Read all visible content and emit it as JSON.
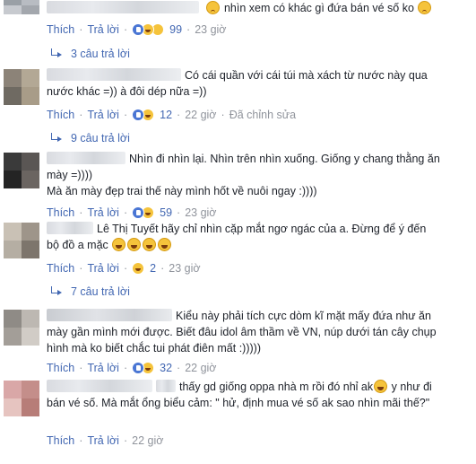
{
  "comments": [
    {
      "text": "nhìn xem có khác gì đứa bán vé số ko",
      "actions": {
        "like": "Thích",
        "reply": "Trả lời",
        "count": "99",
        "time": "23 giờ"
      },
      "replies": "3 câu trả lời"
    },
    {
      "text_line1": "Có cái quần với cái túi mà xách từ nước này qua",
      "text_line2": "nước khác =)) à đôi dép nữa =))",
      "actions": {
        "like": "Thích",
        "reply": "Trả lời",
        "count": "12",
        "time": "22 giờ",
        "edited": "Đã chỉnh sửa"
      },
      "replies": "9 câu trả lời"
    },
    {
      "text_line1": "Nhìn đi nhìn lại. Nhìn trên nhìn xuống. Giống y chang thằng ăn",
      "text_line2": "mày =))))",
      "text_line3": "Mà ăn mày đẹp trai thế này mình hốt về nuôi ngay :))))",
      "actions": {
        "like": "Thích",
        "reply": "Trả lời",
        "count": "59",
        "time": "23 giờ"
      }
    },
    {
      "author": "Lê Thị Tuyết",
      "text_line1": "hãy chỉ nhìn cặp mắt ngơ ngác của a. Đừng để ý đến",
      "text_line2": "bộ đồ a mặc",
      "actions": {
        "like": "Thích",
        "reply": "Trả lời",
        "count": "2",
        "time": "23 giờ"
      },
      "replies": "7 câu trả lời"
    },
    {
      "text_line1": "Kiểu này phải tích cực dòm kĩ mặt mấy đứa như ăn",
      "text_line2": "mày gần mình mới được. Biết đâu idol âm thầm về VN, núp dưới tán cây chụp",
      "text_line3": "hình mà ko biết chắc tui phát điên mất :)))))",
      "actions": {
        "like": "Thích",
        "reply": "Trả lời",
        "count": "32",
        "time": "22 giờ"
      }
    },
    {
      "text_line1a": "thấy gd giống oppa nhà m rồi đó nhỉ ak",
      "text_line1b": "y như đi",
      "text_line2": "bán vé số. Mà mắt ổng biểu cảm: \" hử, định mua vé số ak sao nhìn mãi thế?\"",
      "actions": {
        "like": "Thích",
        "reply": "Trả lời",
        "time": "22 giờ"
      }
    }
  ],
  "colors": {
    "link": "#4267b2",
    "meta": "#90949c",
    "text": "#1d2129"
  }
}
